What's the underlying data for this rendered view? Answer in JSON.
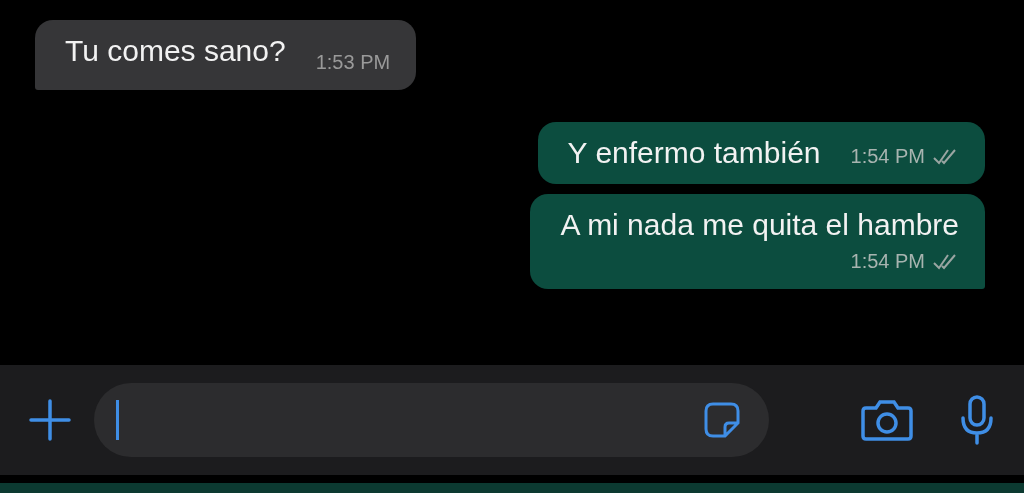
{
  "messages": [
    {
      "outgoing": false,
      "kind": "inline-time",
      "text": "Tu comes sano?",
      "time": "1:53 PM",
      "tail": true
    },
    {
      "outgoing": true,
      "kind": "inline-time",
      "text": "Y enfermo también",
      "time": "1:54 PM",
      "read": false,
      "tail": false
    },
    {
      "outgoing": true,
      "kind": "stacked-time",
      "text": "A mi nada me quita el hambre",
      "time": "1:54 PM",
      "read": false,
      "tail": true
    }
  ]
}
